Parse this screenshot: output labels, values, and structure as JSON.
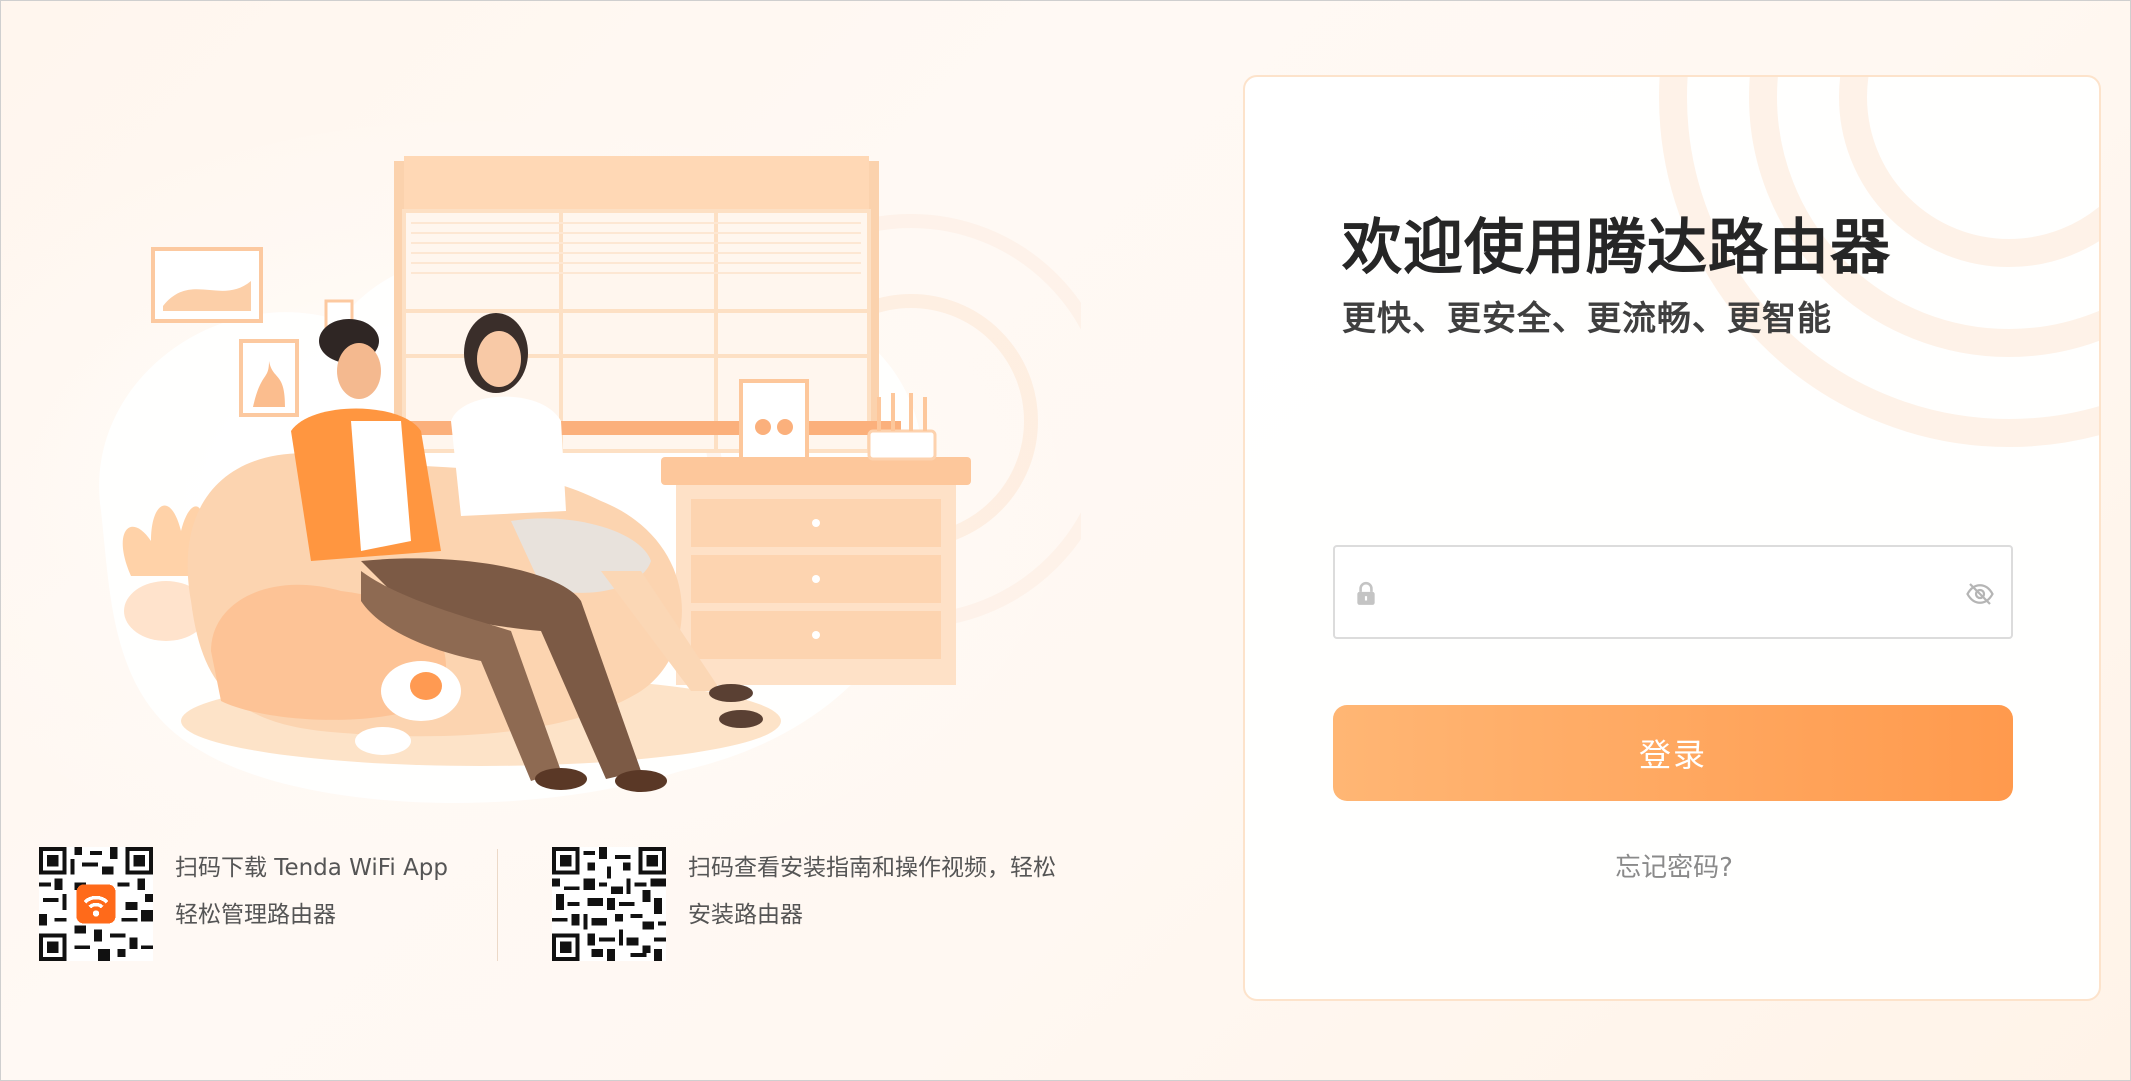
{
  "illustration": {
    "icon": "living-room-illustration"
  },
  "downloads": [
    {
      "icon": "qr-code-app",
      "lines": [
        "扫码下载 Tenda WiFi App",
        "轻松管理路由器"
      ]
    },
    {
      "icon": "qr-code-guide",
      "lines": [
        "扫码查看安装指南和操作视频，轻松",
        "安装路由器"
      ]
    }
  ],
  "login": {
    "title": "欢迎使用腾达路由器",
    "subtitle": "更快、更安全、更流畅、更智能",
    "password": {
      "value": "",
      "placeholder": "",
      "lock_icon": "lock-icon",
      "toggle_icon": "eye-off-icon"
    },
    "submit_label": "登录",
    "forgot_label": "忘记密码?"
  },
  "colors": {
    "accent_start": "#ffb674",
    "accent_end": "#ff9a4d",
    "title": "#262626"
  }
}
